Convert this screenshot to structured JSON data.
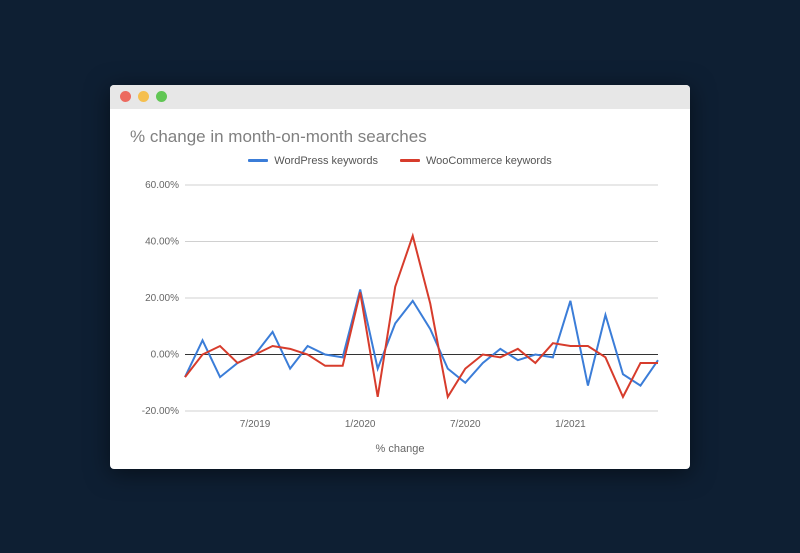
{
  "chart_data": {
    "type": "line",
    "title": "% change in month-on-month searches",
    "xlabel": "% change",
    "ylabel": "",
    "ylim": [
      -20,
      60
    ],
    "y_ticks": [
      -20,
      0,
      20,
      40,
      60
    ],
    "y_tick_labels": [
      "-20.00%",
      "0.00%",
      "20.00%",
      "40.00%",
      "60.00%"
    ],
    "categories": [
      "3/2019",
      "4/2019",
      "5/2019",
      "6/2019",
      "7/2019",
      "8/2019",
      "9/2019",
      "10/2019",
      "11/2019",
      "12/2019",
      "1/2020",
      "2/2020",
      "3/2020",
      "4/2020",
      "5/2020",
      "6/2020",
      "7/2020",
      "8/2020",
      "9/2020",
      "10/2020",
      "11/2020",
      "12/2020",
      "1/2021",
      "2/2021",
      "3/2021",
      "4/2021",
      "5/2021",
      "6/2021"
    ],
    "x_tick_labels": [
      {
        "category": "7/2019",
        "label": "7/2019"
      },
      {
        "category": "1/2020",
        "label": "1/2020"
      },
      {
        "category": "7/2020",
        "label": "7/2020"
      },
      {
        "category": "1/2021",
        "label": "1/2021"
      }
    ],
    "series": [
      {
        "name": "WordPress keywords",
        "color": "#3b7dd8",
        "values": [
          -8,
          5,
          -8,
          -3,
          0,
          8,
          -5,
          3,
          0,
          -1,
          23,
          -5,
          11,
          19,
          9,
          -5,
          -10,
          -3,
          2,
          -2,
          0,
          -1,
          19,
          -11,
          14,
          -7,
          -11,
          -2
        ]
      },
      {
        "name": "WooCommerce keywords",
        "color": "#d73c2c",
        "values": [
          -8,
          0,
          3,
          -3,
          0,
          3,
          2,
          0,
          -4,
          -4,
          22,
          -15,
          24,
          42,
          18,
          -15,
          -5,
          0,
          -1,
          2,
          -3,
          4,
          3,
          3,
          -1,
          -15,
          -3,
          -3
        ]
      }
    ],
    "legend": [
      "WordPress keywords",
      "WooCommerce keywords"
    ]
  }
}
